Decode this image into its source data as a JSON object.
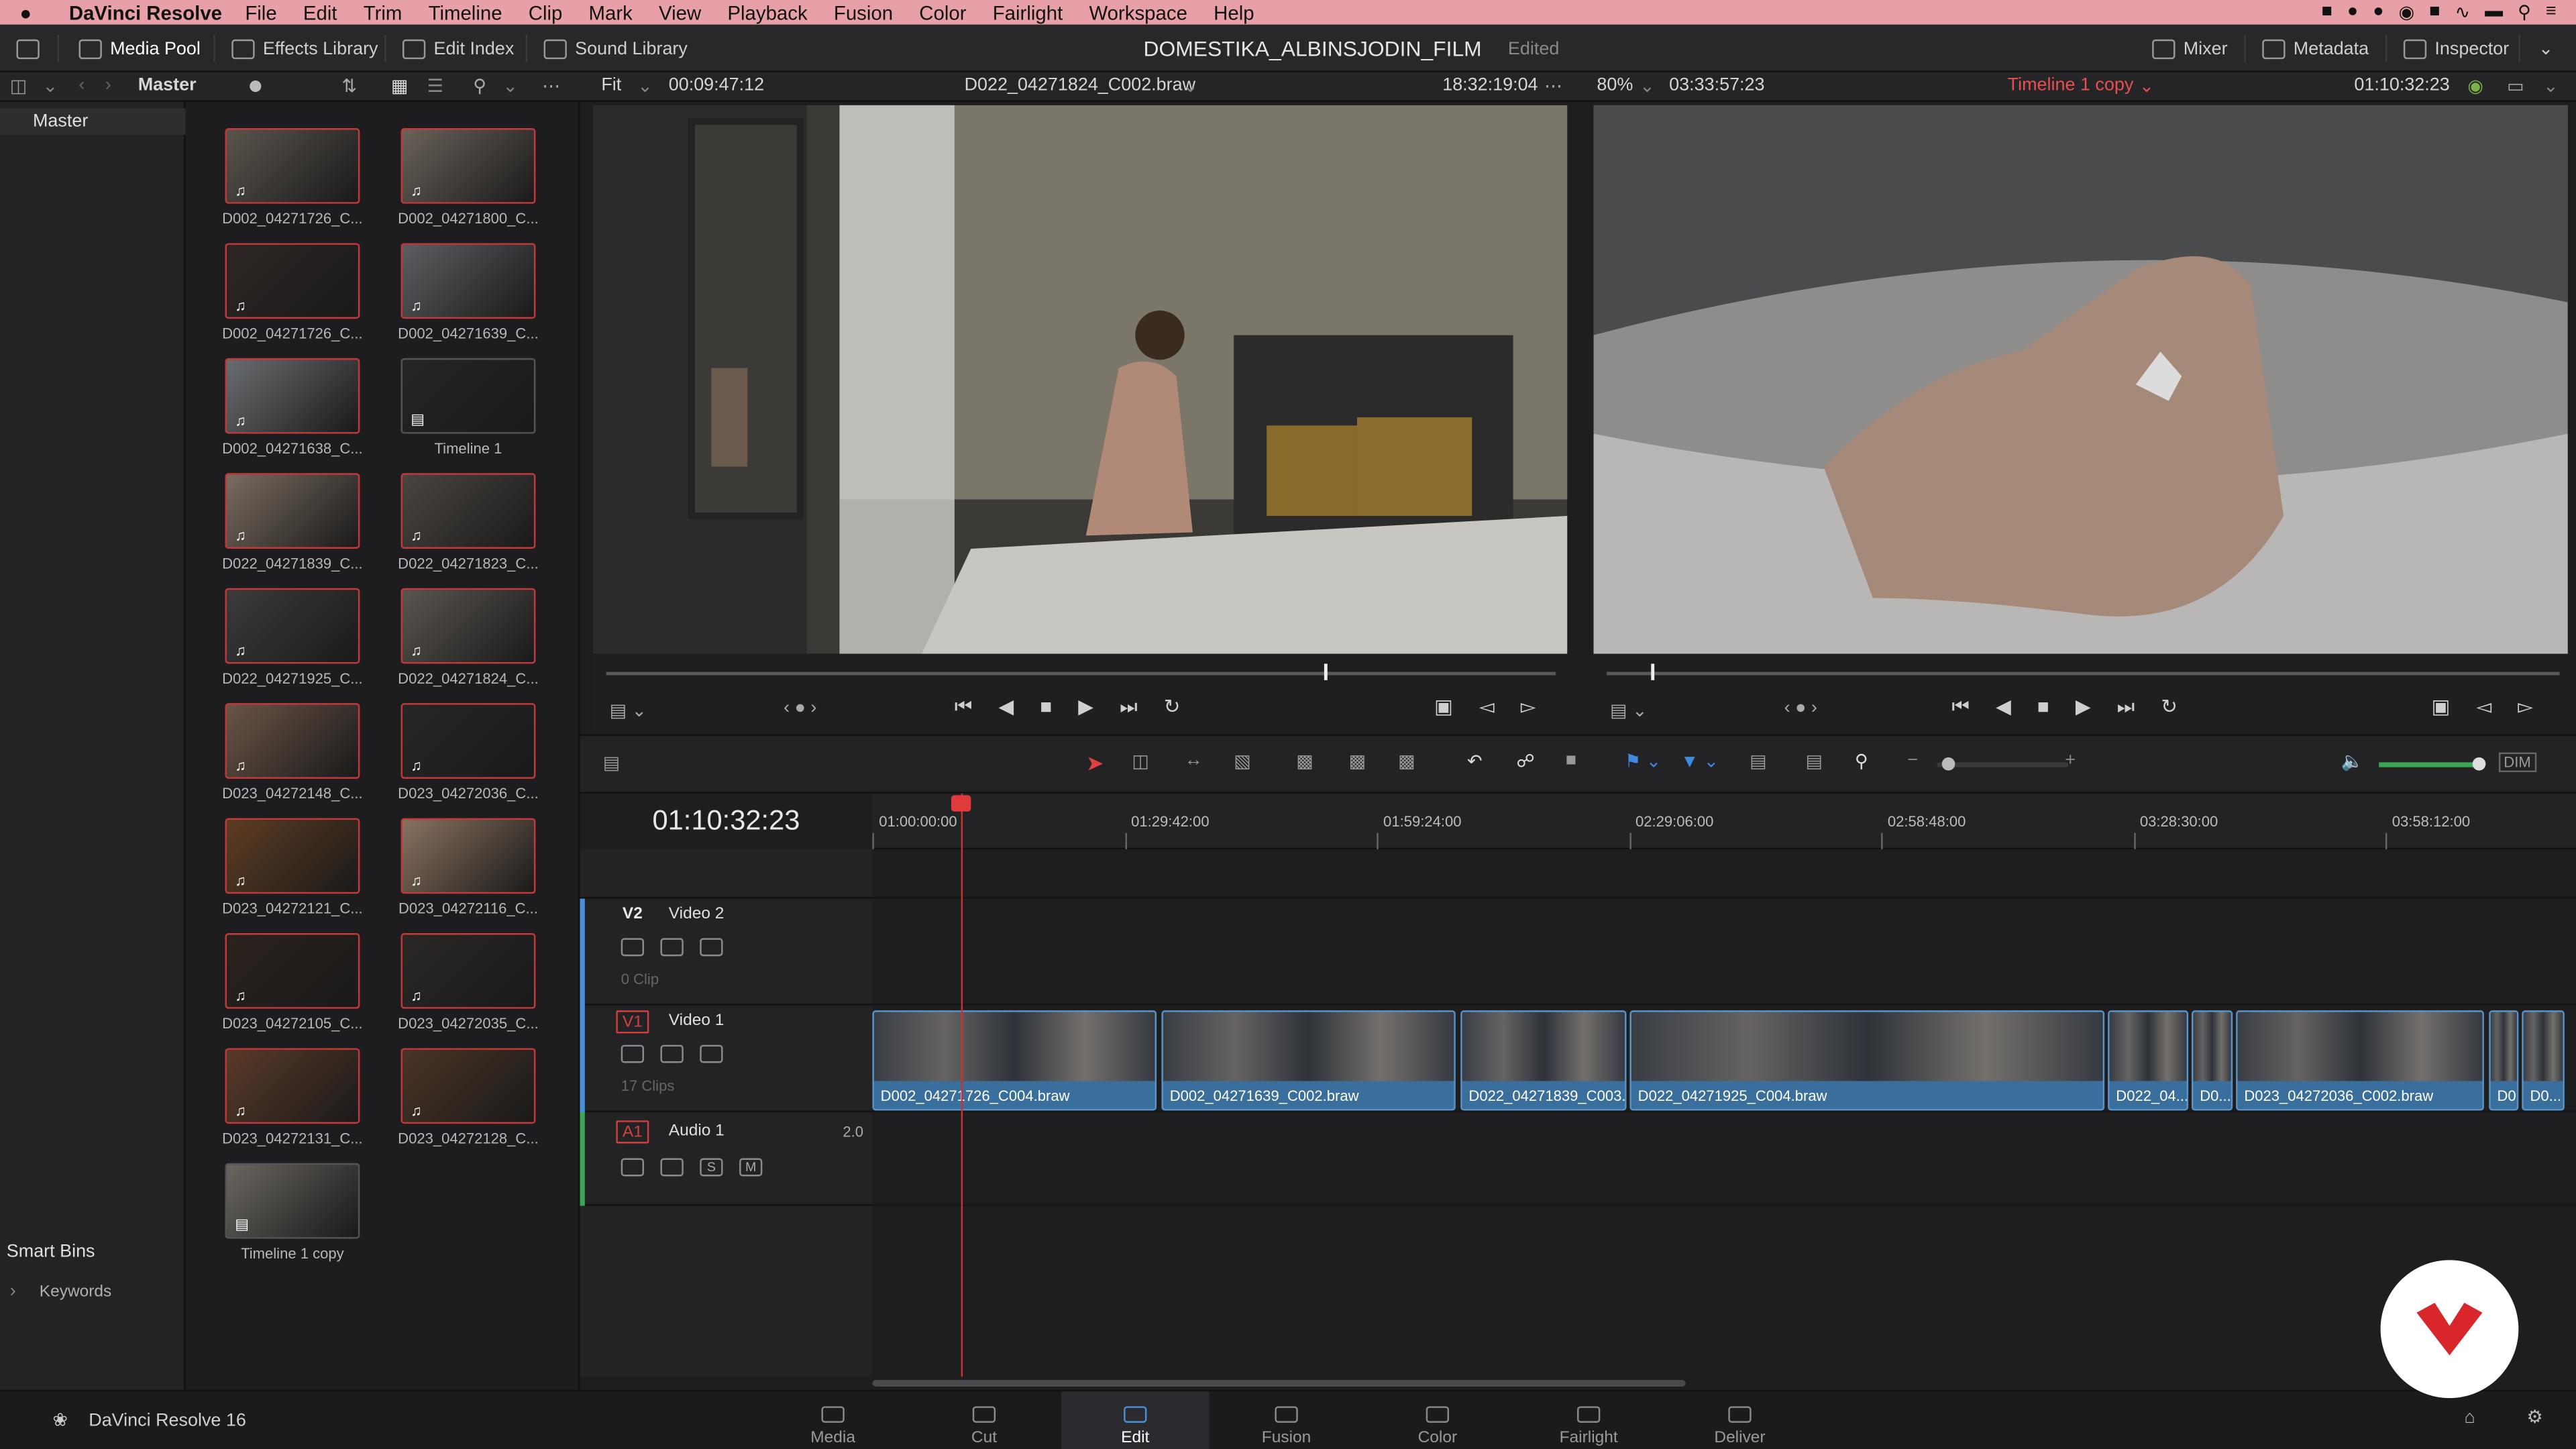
{
  "menubar": {
    "app": "DaVinci Resolve",
    "items": [
      "File",
      "Edit",
      "Trim",
      "Timeline",
      "Clip",
      "Mark",
      "View",
      "Playback",
      "Fusion",
      "Color",
      "Fairlight",
      "Workspace",
      "Help"
    ]
  },
  "topbar": {
    "media_pool": "Media Pool",
    "effects_library": "Effects Library",
    "edit_index": "Edit Index",
    "sound_library": "Sound Library",
    "project_name": "DOMESTIKA_ALBINSJODIN_FILM",
    "project_status": "Edited",
    "mixer": "Mixer",
    "metadata": "Metadata",
    "inspector": "Inspector"
  },
  "subbar": {
    "bin": "Master",
    "fit": "Fit",
    "source_duration": "00:09:47:12",
    "source_clip": "D022_04271824_C002.braw",
    "source_tc": "18:32:19:04",
    "zoom": "80%",
    "timeline_duration": "03:33:57:23",
    "timeline_name": "Timeline 1 copy",
    "timeline_tc": "01:10:32:23"
  },
  "bins": {
    "master": "Master",
    "smart_bins": "Smart Bins",
    "keywords": "Keywords"
  },
  "clips": [
    {
      "label": "D002_04271726_C...",
      "kind": "clip",
      "color": "#5a544c"
    },
    {
      "label": "D002_04271800_C...",
      "kind": "clip",
      "color": "#6b625a"
    },
    {
      "label": "D002_04271726_C...",
      "kind": "clip",
      "color": "#2e2624"
    },
    {
      "label": "D002_04271639_C...",
      "kind": "clip",
      "color": "#5c5e60"
    },
    {
      "label": "D002_04271638_C...",
      "kind": "clip",
      "color": "#6a6d70"
    },
    {
      "label": "Timeline 1",
      "kind": "timeline",
      "color": "#252527"
    },
    {
      "label": "D022_04271839_C...",
      "kind": "clip",
      "color": "#7a6c60"
    },
    {
      "label": "D022_04271823_C...",
      "kind": "clip",
      "color": "#4a4540"
    },
    {
      "label": "D022_04271925_C...",
      "kind": "clip",
      "color": "#3c3b3b"
    },
    {
      "label": "D022_04271824_C...",
      "kind": "clip",
      "color": "#5a5550"
    },
    {
      "label": "D023_04272148_C...",
      "kind": "clip",
      "color": "#6a5446"
    },
    {
      "label": "D023_04272036_C...",
      "kind": "clip",
      "color": "#262626"
    },
    {
      "label": "D023_04272121_C...",
      "kind": "clip",
      "color": "#5e3c22"
    },
    {
      "label": "D023_04272116_C...",
      "kind": "clip",
      "color": "#8a7260"
    },
    {
      "label": "D023_04272105_C...",
      "kind": "clip",
      "color": "#2c221c"
    },
    {
      "label": "D023_04272035_C...",
      "kind": "clip",
      "color": "#2a2726"
    },
    {
      "label": "D023_04272131_C...",
      "kind": "clip",
      "color": "#5a3a28"
    },
    {
      "label": "D023_04272128_C...",
      "kind": "clip",
      "color": "#4a3426"
    },
    {
      "label": "Timeline 1 copy",
      "kind": "timeline",
      "color": "#6a6660"
    }
  ],
  "timeline": {
    "timecode": "01:10:32:23",
    "ruler": [
      "01:00:00:00",
      "01:29:42:00",
      "01:59:24:00",
      "02:29:06:00",
      "02:58:48:00",
      "03:28:30:00",
      "03:58:12:00"
    ],
    "tracks": {
      "v2": {
        "tag": "V2",
        "name": "Video 2",
        "count": "0 Clip"
      },
      "v1": {
        "tag": "V1",
        "name": "Video 1",
        "count": "17 Clips"
      },
      "a1": {
        "tag": "A1",
        "name": "Audio 1",
        "level": "2.0",
        "solo": "S",
        "mute": "M"
      }
    },
    "clips": [
      {
        "label": "D002_04271726_C004.braw",
        "start": 0,
        "end": 173
      },
      {
        "label": "D002_04271639_C002.braw",
        "start": 176,
        "end": 355
      },
      {
        "label": "D022_04271839_C003...",
        "start": 358,
        "end": 459
      },
      {
        "label": "D022_04271925_C004.braw",
        "start": 461,
        "end": 750
      },
      {
        "label": "D022_04...",
        "start": 752,
        "end": 801
      },
      {
        "label": "D0...",
        "start": 803,
        "end": 828
      },
      {
        "label": "D023_04272036_C002.braw",
        "start": 830,
        "end": 981
      },
      {
        "label": "D0...",
        "start": 984,
        "end": 1002
      },
      {
        "label": "D0...",
        "start": 1004,
        "end": 1030
      }
    ]
  },
  "pages": [
    "Media",
    "Cut",
    "Edit",
    "Fusion",
    "Color",
    "Fairlight",
    "Deliver"
  ],
  "active_page": "Edit",
  "footer": {
    "app_version": "DaVinci Resolve 16",
    "dim": "DIM"
  },
  "colors": {
    "accent": "#4a8fd9",
    "playhead": "#d03030",
    "clip": "#3a6e9c",
    "menubar": "#e8a0a8"
  }
}
